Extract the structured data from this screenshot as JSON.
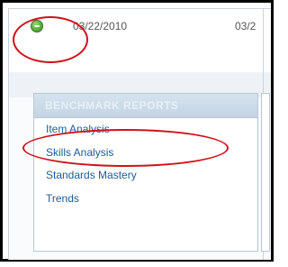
{
  "status": {
    "icon": "green-minus-circle-icon",
    "date_primary": "03/22/2010",
    "date_secondary": "03/2"
  },
  "panel": {
    "header": "BENCHMARK REPORTS",
    "items": [
      {
        "label": "Item Analysis"
      },
      {
        "label": "Skills Analysis"
      },
      {
        "label": "Standards Mastery"
      },
      {
        "label": "Trends"
      }
    ]
  },
  "colors": {
    "link": "#1a5c9a",
    "header_bg": "#c3d4e4",
    "highlight": "#d0121b",
    "status_green": "#55a93a"
  }
}
